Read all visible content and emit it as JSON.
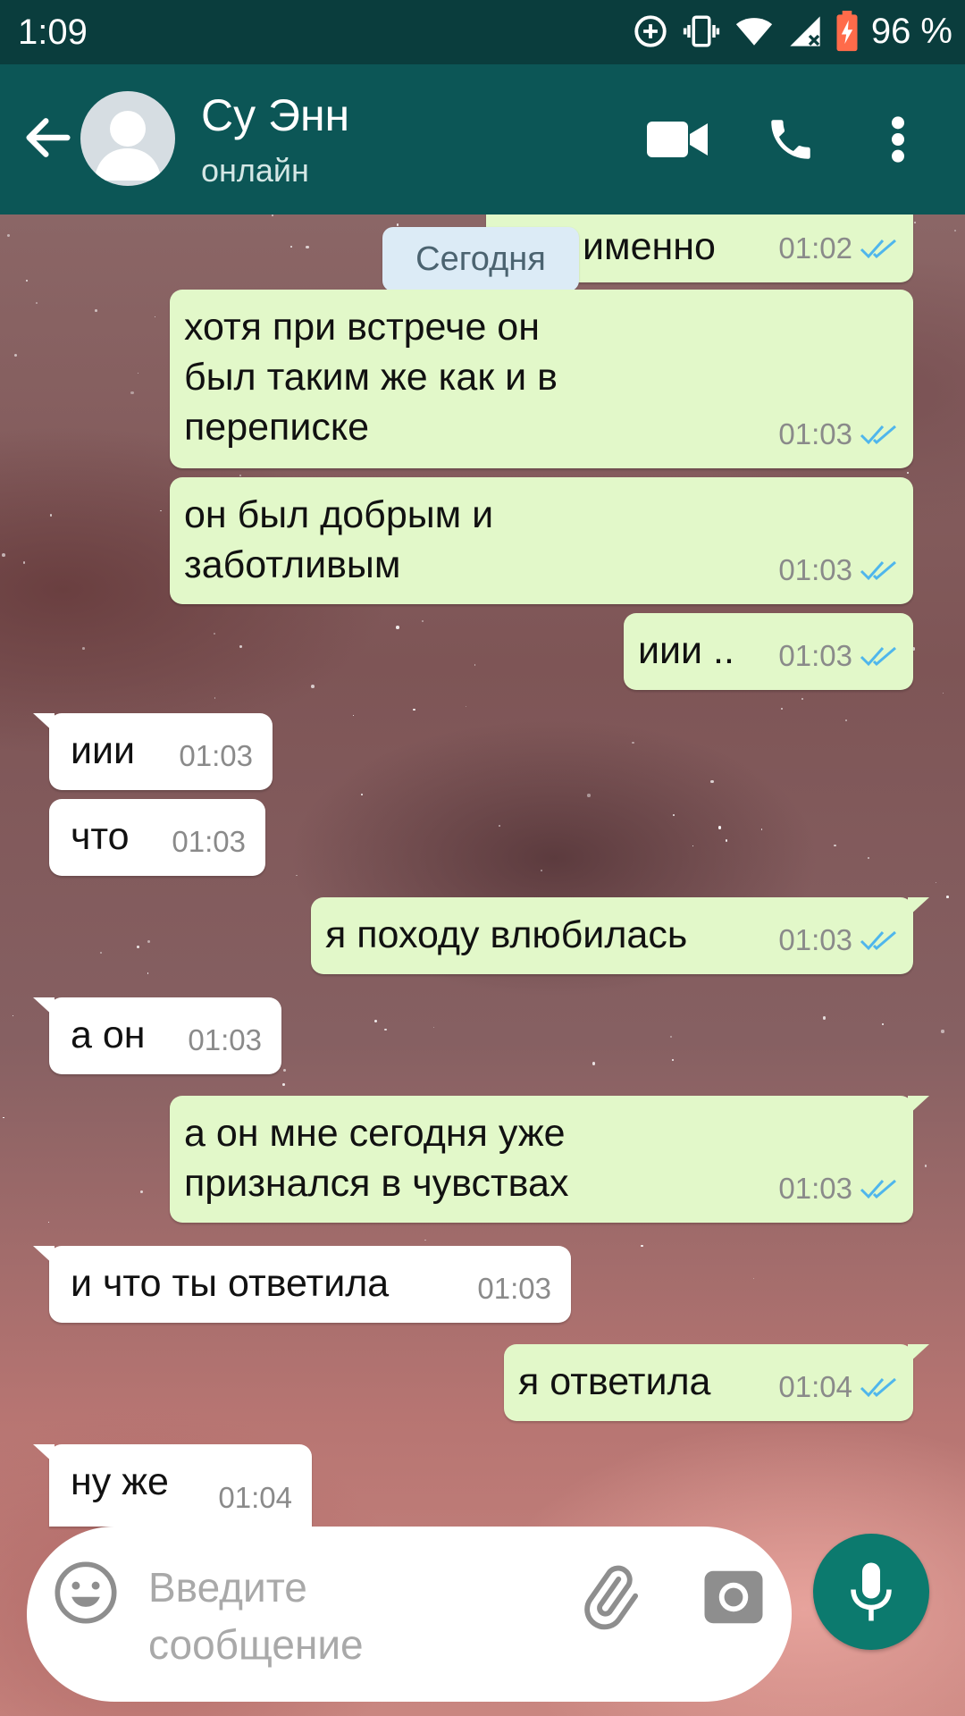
{
  "status_bar": {
    "time": "1:09",
    "battery_percent": "96 %",
    "icons": [
      "data-saver-icon",
      "vibrate-icon",
      "wifi-icon",
      "cell-signal-icon",
      "battery-charging-icon"
    ]
  },
  "header": {
    "contact_name": "Су Энн",
    "contact_status": "онлайн",
    "icons": [
      "back-arrow-icon",
      "avatar-placeholder-icon",
      "video-call-icon",
      "phone-call-icon",
      "more-options-icon"
    ]
  },
  "date_chip": "Сегодня",
  "messages": [
    {
      "dir": "out",
      "text": "именно",
      "time": "01:02",
      "read": true
    },
    {
      "dir": "out",
      "text": "хотя при встрече он\nбыл таким же как и в\nпереписке",
      "time": "01:03",
      "read": true
    },
    {
      "dir": "out",
      "text": "он был добрым и\nзаботливым",
      "time": "01:03",
      "read": true
    },
    {
      "dir": "out",
      "text": "иии ..",
      "time": "01:03",
      "read": true
    },
    {
      "dir": "in",
      "text": "иии",
      "time": "01:03"
    },
    {
      "dir": "in",
      "text": "что",
      "time": "01:03"
    },
    {
      "dir": "out",
      "text": "я походу влюбилась",
      "time": "01:03",
      "read": true
    },
    {
      "dir": "in",
      "text": "а он",
      "time": "01:03"
    },
    {
      "dir": "out",
      "text": "а он мне сегодня уже\nпризнался в чувствах",
      "time": "01:03",
      "read": true
    },
    {
      "dir": "in",
      "text": "и что ты ответила",
      "time": "01:03"
    },
    {
      "dir": "out",
      "text": "я ответила",
      "time": "01:04",
      "read": true
    },
    {
      "dir": "in",
      "text": "ну же",
      "time": "01:04"
    }
  ],
  "composer": {
    "placeholder": "Введите\nсообщение",
    "icons": [
      "emoji-icon",
      "attach-icon",
      "camera-icon",
      "mic-icon"
    ]
  },
  "colors": {
    "status_bar": "#0a3d3d",
    "app_bar": "#0c5656",
    "outgoing_bubble": "#e2f8c9",
    "incoming_bubble": "#ffffff",
    "read_check": "#4fb6ec",
    "mic_button": "#0c7a6e"
  }
}
